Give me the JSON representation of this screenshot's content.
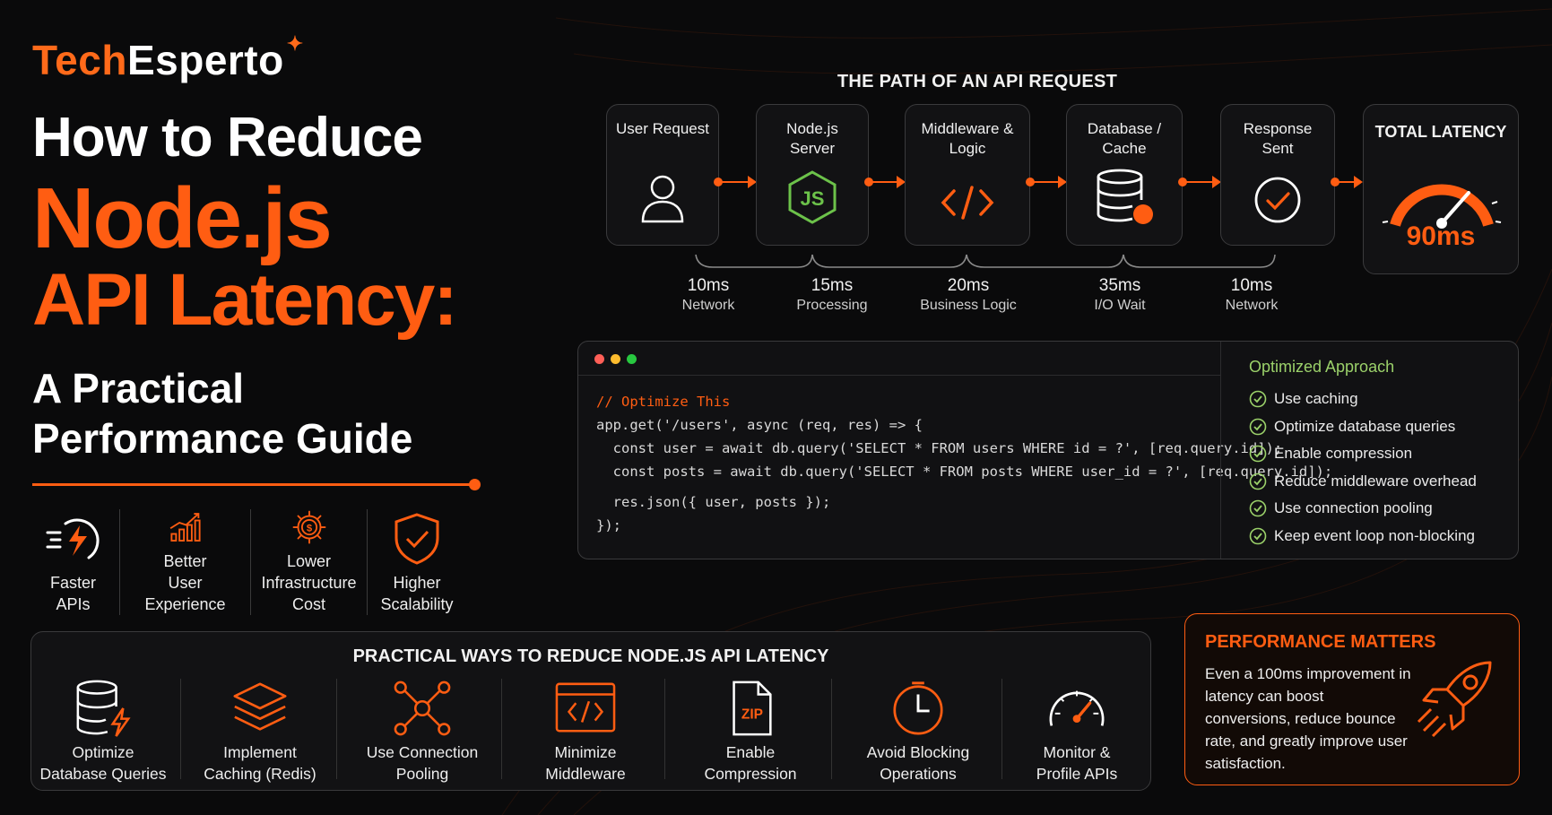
{
  "brand": {
    "prefix": "Tech",
    "suffix": "Esperto"
  },
  "headline": {
    "line1": "How to Reduce",
    "line2": "Node.js",
    "line3": "API Latency:",
    "line4": "A Practical",
    "line5": "Performance Guide"
  },
  "benefits": [
    {
      "icon": "fast-bolt-icon",
      "label": "Faster\nAPIs"
    },
    {
      "icon": "growth-chart-icon",
      "label": "Better\nUser Experience"
    },
    {
      "icon": "cost-gear-icon",
      "label": "Lower\nInfrastructure Cost"
    },
    {
      "icon": "shield-check-icon",
      "label": "Higher\nScalability"
    }
  ],
  "path": {
    "title": "THE PATH OF AN API REQUEST",
    "stages": [
      {
        "name": "User Request",
        "icon": "user-icon"
      },
      {
        "name": "Node.js\nServer",
        "icon": "nodejs-icon"
      },
      {
        "name": "Middleware &\nLogic",
        "icon": "code-icon"
      },
      {
        "name": "Database /\nCache",
        "icon": "database-icon"
      },
      {
        "name": "Response\nSent",
        "icon": "check-circle-icon"
      }
    ],
    "total_label": "TOTAL LATENCY",
    "total_value": "90ms",
    "timings": [
      {
        "ms": "10ms",
        "label": "Network"
      },
      {
        "ms": "15ms",
        "label": "Processing"
      },
      {
        "ms": "20ms",
        "label": "Business Logic"
      },
      {
        "ms": "35ms",
        "label": "I/O Wait"
      },
      {
        "ms": "10ms",
        "label": "Network"
      }
    ]
  },
  "code": {
    "comment": "// Optimize This",
    "lines": [
      "app.get('/users', async (req, res) => {",
      "  const user = await db.query('SELECT * FROM users WHERE id = ?', [req.query.id]);",
      "  const posts = await db.query('SELECT * FROM posts WHERE user_id = ?', [req.query.id]);",
      "",
      "  res.json({ user, posts });",
      "});"
    ]
  },
  "optimized": {
    "title": "Optimized Approach",
    "items": [
      "Use caching",
      "Optimize database queries",
      "Enable compression",
      "Reduce middleware overhead",
      "Use connection pooling",
      "Keep event loop non-blocking"
    ]
  },
  "ways": {
    "title": "PRACTICAL WAYS TO REDUCE NODE.JS API LATENCY",
    "items": [
      {
        "icon": "database-bolt-icon",
        "label": "Optimize\nDatabase Queries"
      },
      {
        "icon": "layers-icon",
        "label": "Implement\nCaching (Redis)"
      },
      {
        "icon": "network-nodes-icon",
        "label": "Use Connection\nPooling"
      },
      {
        "icon": "code-window-icon",
        "label": "Minimize\nMiddleware"
      },
      {
        "icon": "zip-file-icon",
        "label": "Enable\nCompression"
      },
      {
        "icon": "clock-icon",
        "label": "Avoid Blocking\nOperations"
      },
      {
        "icon": "gauge-icon",
        "label": "Monitor &\nProfile APIs"
      }
    ]
  },
  "performance": {
    "title": "PERFORMANCE MATTERS",
    "body": "Even a 100ms improvement in latency can boost conversions, reduce bounce rate, and greatly improve user satisfaction.",
    "icon": "rocket-icon"
  },
  "colors": {
    "accent": "#ff5d12",
    "green": "#9bd16a",
    "bg": "#0a0a0b"
  }
}
